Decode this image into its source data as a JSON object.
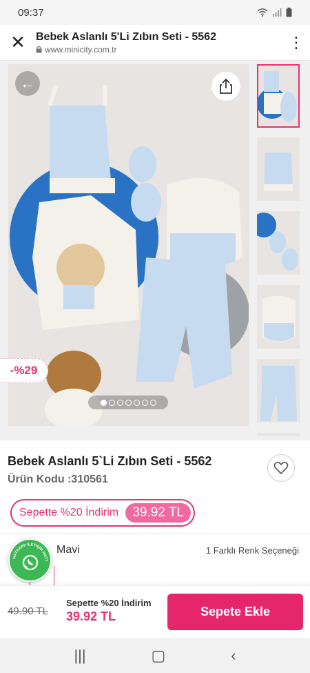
{
  "status_bar": {
    "time": "09:37"
  },
  "browser": {
    "title": "Bebek Aslanlı 5'Li Zıbın Seti - 5562",
    "url": "www.minicity.com.tr"
  },
  "gallery": {
    "discount_badge": "-%29",
    "image_count": 6,
    "active_index": 0
  },
  "product": {
    "name": "Bebek Aslanlı 5`Li Zıbın Seti - 5562",
    "code": "Ürün Kodu :310561",
    "promo_label": "Sepette %20 İndirim",
    "promo_price": "39.92 TL"
  },
  "color": {
    "label": "Mavi",
    "options_text": "1 Farklı Renk Seçeneği"
  },
  "whatsapp": {
    "label": "WHATSAPP İLETİŞİM HATTI"
  },
  "bottom_bar": {
    "old_price": "49.90 TL",
    "promo_label": "Sepette %20 İndirim",
    "promo_price": "39.92 TL",
    "add_to_cart": "Sepete Ekle"
  },
  "colors": {
    "accent": "#e8336e",
    "button": "#e6266b",
    "whatsapp": "#3db854",
    "product_blue": "#c6dbf0",
    "bg_blue": "#2a72c4"
  }
}
